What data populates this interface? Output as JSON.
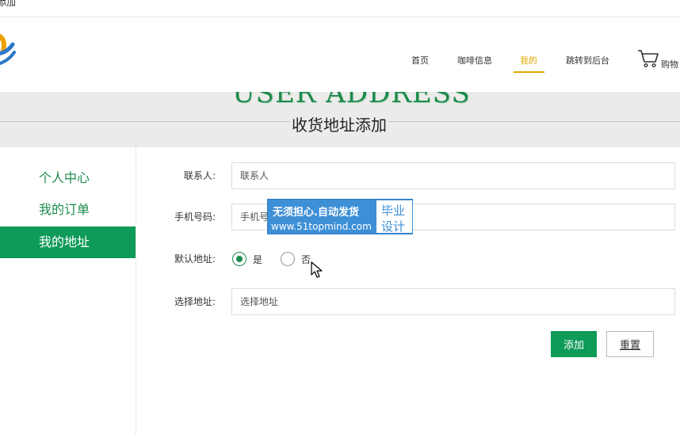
{
  "top_strip": {
    "tab_text": "添加"
  },
  "nav": {
    "items": [
      {
        "label": "首页",
        "active": false
      },
      {
        "label": "咖啡信息",
        "active": false
      },
      {
        "label": "我的",
        "active": true
      },
      {
        "label": "跳转到后台",
        "active": false
      }
    ],
    "cart_label": "购物",
    "accent_color": "#e0a800"
  },
  "banner": {
    "english_title": "USER ADDRESS",
    "chinese_title": "收货地址添加"
  },
  "sidebar": {
    "items": [
      {
        "label": "个人中心",
        "active": false
      },
      {
        "label": "我的订单",
        "active": false
      },
      {
        "label": "我的地址",
        "active": true
      }
    ],
    "accent_color": "#0e9a58"
  },
  "form": {
    "contact": {
      "label": "联系人:",
      "placeholder": "联系人"
    },
    "phone": {
      "label": "手机号码:",
      "placeholder": "手机号"
    },
    "default": {
      "label": "默认地址:",
      "options": [
        "是",
        "否"
      ],
      "selected": "是"
    },
    "address": {
      "label": "选择地址:",
      "placeholder": "选择地址"
    },
    "add_button": "添加",
    "reset_button": "重置"
  },
  "watermark": {
    "line1": "无须担心.自动发货",
    "line2": "www.51topmind.com",
    "box_line1": "毕业",
    "box_line2": "设计"
  }
}
